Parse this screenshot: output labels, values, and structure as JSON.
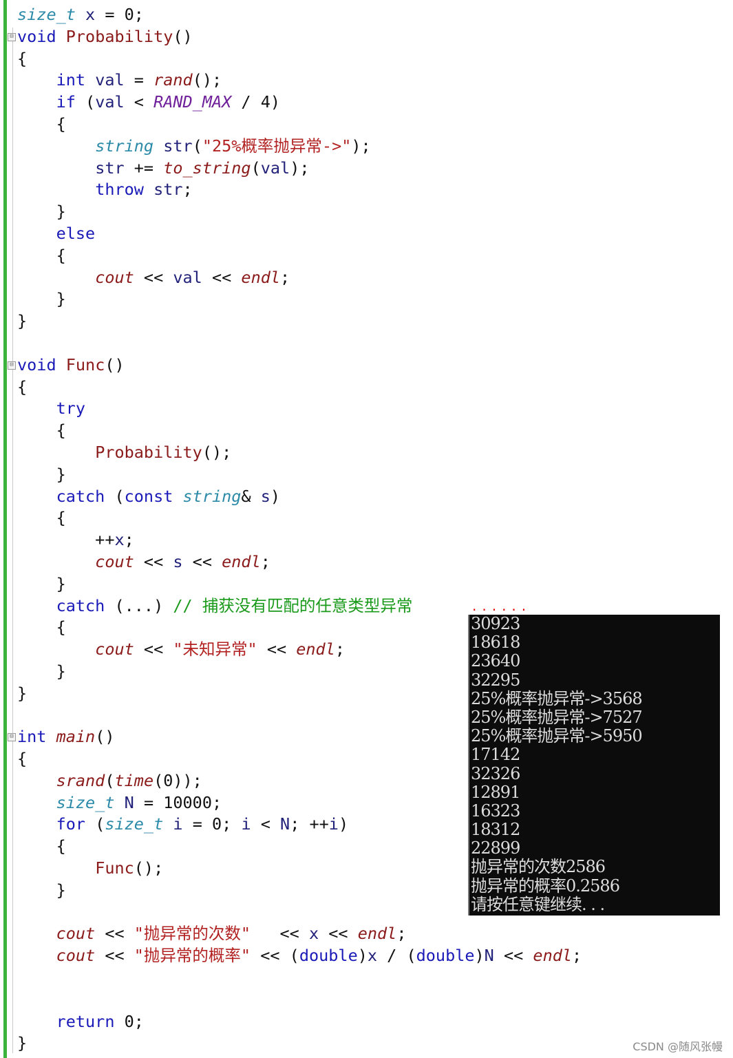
{
  "editor": {
    "fold_marker": "⊟",
    "fold_lines": [
      1,
      16,
      33
    ],
    "lines": [
      [
        [
          "t",
          "size_t"
        ],
        [
          "p",
          " "
        ],
        [
          "v",
          "x"
        ],
        [
          "p",
          " = 0;"
        ]
      ],
      [
        [
          "k",
          "void"
        ],
        [
          "p",
          " "
        ],
        [
          "f",
          "Probability"
        ],
        [
          "p",
          "()"
        ]
      ],
      [
        [
          "p",
          "{"
        ]
      ],
      [
        [
          "p",
          "    "
        ],
        [
          "k",
          "int"
        ],
        [
          "p",
          " "
        ],
        [
          "v",
          "val"
        ],
        [
          "p",
          " = "
        ],
        [
          "fi",
          "rand"
        ],
        [
          "p",
          "();"
        ]
      ],
      [
        [
          "p",
          "    "
        ],
        [
          "k",
          "if"
        ],
        [
          "p",
          " ("
        ],
        [
          "v",
          "val"
        ],
        [
          "p",
          " < "
        ],
        [
          "m",
          "RAND_MAX"
        ],
        [
          "p",
          " / 4)"
        ]
      ],
      [
        [
          "p",
          "    {"
        ]
      ],
      [
        [
          "p",
          "        "
        ],
        [
          "t",
          "string"
        ],
        [
          "p",
          " "
        ],
        [
          "v",
          "str"
        ],
        [
          "p",
          "("
        ],
        [
          "s",
          "\"25%概率抛异常->\""
        ],
        [
          "p",
          ");"
        ]
      ],
      [
        [
          "p",
          "        "
        ],
        [
          "v",
          "str"
        ],
        [
          "p",
          " += "
        ],
        [
          "fi",
          "to_string"
        ],
        [
          "p",
          "("
        ],
        [
          "v",
          "val"
        ],
        [
          "p",
          ");"
        ]
      ],
      [
        [
          "p",
          "        "
        ],
        [
          "k",
          "throw"
        ],
        [
          "p",
          " "
        ],
        [
          "v",
          "str"
        ],
        [
          "p",
          ";"
        ]
      ],
      [
        [
          "p",
          "    }"
        ]
      ],
      [
        [
          "p",
          "    "
        ],
        [
          "k",
          "else"
        ]
      ],
      [
        [
          "p",
          "    {"
        ]
      ],
      [
        [
          "p",
          "        "
        ],
        [
          "fi",
          "cout"
        ],
        [
          "p",
          " << "
        ],
        [
          "v",
          "val"
        ],
        [
          "p",
          " << "
        ],
        [
          "fi",
          "endl"
        ],
        [
          "p",
          ";"
        ]
      ],
      [
        [
          "p",
          "    }"
        ]
      ],
      [
        [
          "p",
          "}"
        ]
      ],
      [],
      [
        [
          "k",
          "void"
        ],
        [
          "p",
          " "
        ],
        [
          "f",
          "Func"
        ],
        [
          "p",
          "()"
        ]
      ],
      [
        [
          "p",
          "{"
        ]
      ],
      [
        [
          "p",
          "    "
        ],
        [
          "k",
          "try"
        ]
      ],
      [
        [
          "p",
          "    {"
        ]
      ],
      [
        [
          "p",
          "        "
        ],
        [
          "f",
          "Probability"
        ],
        [
          "p",
          "();"
        ]
      ],
      [
        [
          "p",
          "    }"
        ]
      ],
      [
        [
          "p",
          "    "
        ],
        [
          "k",
          "catch"
        ],
        [
          "p",
          " ("
        ],
        [
          "k",
          "const"
        ],
        [
          "p",
          " "
        ],
        [
          "t",
          "string"
        ],
        [
          "p",
          "& "
        ],
        [
          "v",
          "s"
        ],
        [
          "p",
          ")"
        ]
      ],
      [
        [
          "p",
          "    {"
        ]
      ],
      [
        [
          "p",
          "        ++"
        ],
        [
          "v",
          "x"
        ],
        [
          "p",
          ";"
        ]
      ],
      [
        [
          "p",
          "        "
        ],
        [
          "fi",
          "cout"
        ],
        [
          "p",
          " << "
        ],
        [
          "v",
          "s"
        ],
        [
          "p",
          " << "
        ],
        [
          "fi",
          "endl"
        ],
        [
          "p",
          ";"
        ]
      ],
      [
        [
          "p",
          "    }"
        ]
      ],
      [
        [
          "p",
          "    "
        ],
        [
          "k",
          "catch"
        ],
        [
          "p",
          " (...) "
        ],
        [
          "c",
          "// 捕获没有匹配的任意类型异常"
        ]
      ],
      [
        [
          "p",
          "    {"
        ]
      ],
      [
        [
          "p",
          "        "
        ],
        [
          "fi",
          "cout"
        ],
        [
          "p",
          " << "
        ],
        [
          "s",
          "\"未知异常\""
        ],
        [
          "p",
          " << "
        ],
        [
          "fi",
          "endl"
        ],
        [
          "p",
          ";"
        ]
      ],
      [
        [
          "p",
          "    }"
        ]
      ],
      [
        [
          "p",
          "}"
        ]
      ],
      [],
      [
        [
          "k",
          "int"
        ],
        [
          "p",
          " "
        ],
        [
          "fi",
          "main"
        ],
        [
          "p",
          "()"
        ]
      ],
      [
        [
          "p",
          "{"
        ]
      ],
      [
        [
          "p",
          "    "
        ],
        [
          "fi",
          "srand"
        ],
        [
          "p",
          "("
        ],
        [
          "fi",
          "time"
        ],
        [
          "p",
          "(0));"
        ]
      ],
      [
        [
          "p",
          "    "
        ],
        [
          "t",
          "size_t"
        ],
        [
          "p",
          " "
        ],
        [
          "v",
          "N"
        ],
        [
          "p",
          " = 10000;"
        ]
      ],
      [
        [
          "p",
          "    "
        ],
        [
          "k",
          "for"
        ],
        [
          "p",
          " ("
        ],
        [
          "t",
          "size_t"
        ],
        [
          "p",
          " "
        ],
        [
          "v",
          "i"
        ],
        [
          "p",
          " = 0; "
        ],
        [
          "v",
          "i"
        ],
        [
          "p",
          " < "
        ],
        [
          "v",
          "N"
        ],
        [
          "p",
          "; ++"
        ],
        [
          "v",
          "i"
        ],
        [
          "p",
          ")"
        ]
      ],
      [
        [
          "p",
          "    {"
        ]
      ],
      [
        [
          "p",
          "        "
        ],
        [
          "f",
          "Func"
        ],
        [
          "p",
          "();"
        ]
      ],
      [
        [
          "p",
          "    }"
        ]
      ],
      [],
      [
        [
          "p",
          "    "
        ],
        [
          "fi",
          "cout"
        ],
        [
          "p",
          " << "
        ],
        [
          "s",
          "\"抛异常的次数\""
        ],
        [
          "p",
          "   << "
        ],
        [
          "v",
          "x"
        ],
        [
          "p",
          " << "
        ],
        [
          "fi",
          "endl"
        ],
        [
          "p",
          ";"
        ]
      ],
      [
        [
          "p",
          "    "
        ],
        [
          "fi",
          "cout"
        ],
        [
          "p",
          " << "
        ],
        [
          "s",
          "\"抛异常的概率\""
        ],
        [
          "p",
          " << ("
        ],
        [
          "k",
          "double"
        ],
        [
          "p",
          ")"
        ],
        [
          "v",
          "x"
        ],
        [
          "p",
          " / ("
        ],
        [
          "k",
          "double"
        ],
        [
          "p",
          ")"
        ],
        [
          "v",
          "N"
        ],
        [
          "p",
          " << "
        ],
        [
          "fi",
          "endl"
        ],
        [
          "p",
          ";"
        ]
      ],
      [],
      [],
      [
        [
          "p",
          "    "
        ],
        [
          "k",
          "return"
        ],
        [
          "p",
          " 0;"
        ]
      ],
      [
        [
          "p",
          "}"
        ]
      ]
    ]
  },
  "console": {
    "dots": "......",
    "lines": [
      "30923",
      "18618",
      "23640",
      "32295",
      "25%概率抛异常->3568",
      "25%概率抛异常->7527",
      "25%概率抛异常->5950",
      "17142",
      "32326",
      "12891",
      "16323",
      "18312",
      "22899",
      "抛异常的次数2586",
      "抛异常的概率0.2586",
      "请按任意键继续. . ."
    ]
  },
  "watermark": "CSDN @随风张幔"
}
